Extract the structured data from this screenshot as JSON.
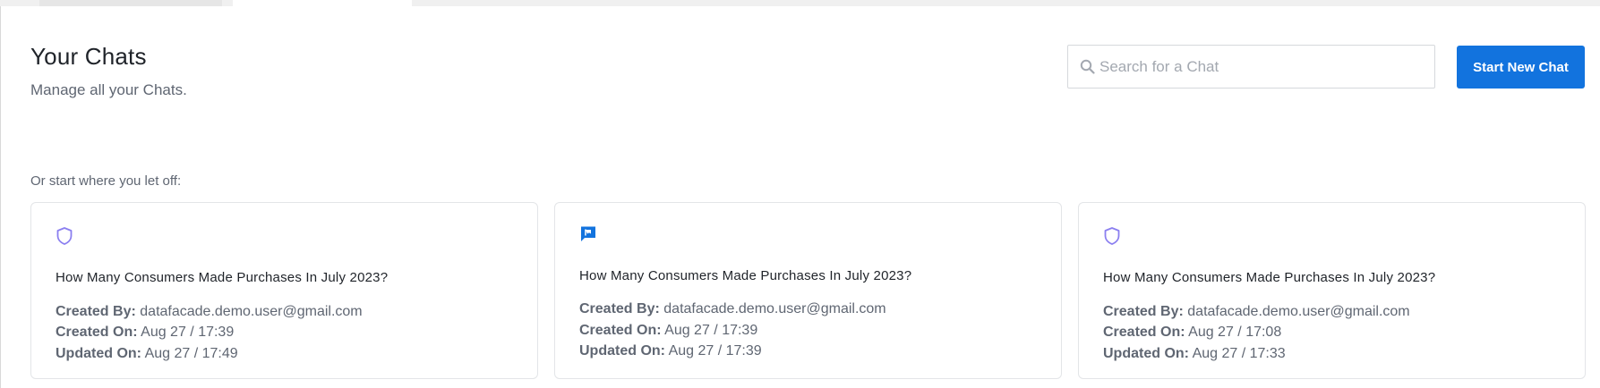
{
  "header": {
    "title": "Your Chats",
    "subtitle": "Manage all your Chats."
  },
  "search": {
    "placeholder": "Search for a Chat",
    "value": "",
    "icon": "search-icon"
  },
  "actions": {
    "new_chat_label": "Start New Chat",
    "accent_color": "#1273de"
  },
  "recent": {
    "label": "Or start where you let off:",
    "created_by_label": "Created By:",
    "created_on_label": "Created On:",
    "updated_on_label": "Updated On:",
    "cards": [
      {
        "icon": "shield-icon",
        "icon_color": "#8b7ff0",
        "title": "How Many Consumers Made Purchases In July 2023?",
        "created_by": "datafacade.demo.user@gmail.com",
        "created_on": "Aug 27 / 17:39",
        "updated_on": "Aug 27 / 17:49"
      },
      {
        "icon": "flag-chat-icon",
        "icon_color": "#1273de",
        "title": "How Many Consumers Made Purchases In July 2023?",
        "created_by": "datafacade.demo.user@gmail.com",
        "created_on": "Aug 27 / 17:39",
        "updated_on": "Aug 27 / 17:39"
      },
      {
        "icon": "shield-icon",
        "icon_color": "#8b7ff0",
        "title": "How Many Consumers Made Purchases In July 2023?",
        "created_by": "datafacade.demo.user@gmail.com",
        "created_on": "Aug 27 / 17:08",
        "updated_on": "Aug 27 / 17:33"
      }
    ]
  }
}
